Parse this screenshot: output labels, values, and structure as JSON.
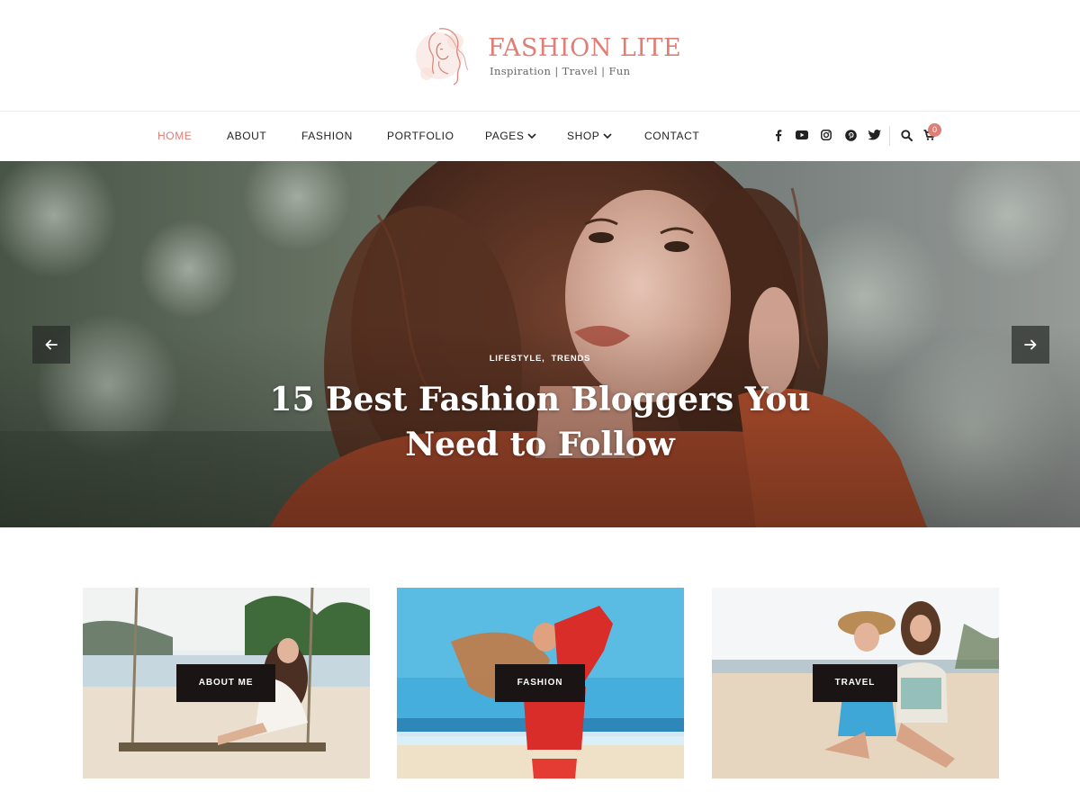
{
  "site": {
    "title": "FASHION LITE",
    "tagline": "Inspiration | Travel | Fun",
    "accent_color": "#e07d75"
  },
  "nav": {
    "items": [
      {
        "label": "HOME",
        "active": true
      },
      {
        "label": "ABOUT"
      },
      {
        "label": "FASHION"
      },
      {
        "label": "PORTFOLIO"
      },
      {
        "label": "PAGES",
        "dropdown": true
      },
      {
        "label": "SHOP",
        "dropdown": true
      },
      {
        "label": "CONTACT"
      }
    ],
    "social_icons": [
      "facebook-icon",
      "youtube-icon",
      "instagram-icon",
      "pinterest-icon",
      "twitter-icon"
    ],
    "search_icon": "search-icon",
    "cart_icon": "cart-icon",
    "cart_count": "0"
  },
  "hero": {
    "categories": [
      "LIFESTYLE",
      "TRENDS"
    ],
    "category_separator": ",",
    "title": "15 Best Fashion Bloggers You Need to Follow",
    "prev_icon": "arrow-left-icon",
    "next_icon": "arrow-right-icon"
  },
  "promo_cards": [
    {
      "label": "ABOUT ME"
    },
    {
      "label": "FASHION"
    },
    {
      "label": "TRAVEL"
    }
  ]
}
